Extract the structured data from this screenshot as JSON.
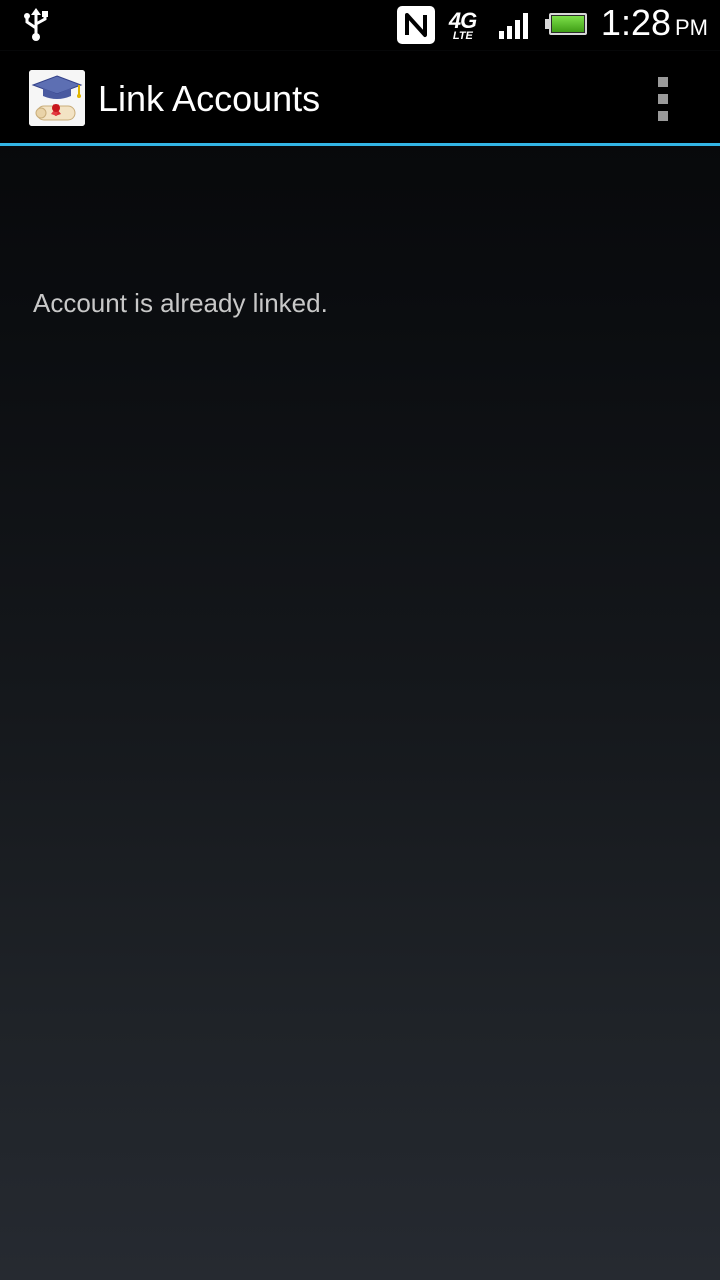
{
  "status_bar": {
    "icons": [
      "usb-icon",
      "nfc-icon",
      "network-4g-lte-icon",
      "signal-icon",
      "battery-icon"
    ],
    "network_type": "4G",
    "network_sub": "LTE",
    "time": "1:28",
    "ampm": "PM",
    "battery_color": "#4cc22a"
  },
  "action_bar": {
    "app_icon": "graduation-cap-diploma-icon",
    "title": "Link Accounts",
    "menu_icon": "overflow-menu-icon",
    "accent_color": "#33b5e5"
  },
  "content": {
    "message": "Account is already linked."
  }
}
